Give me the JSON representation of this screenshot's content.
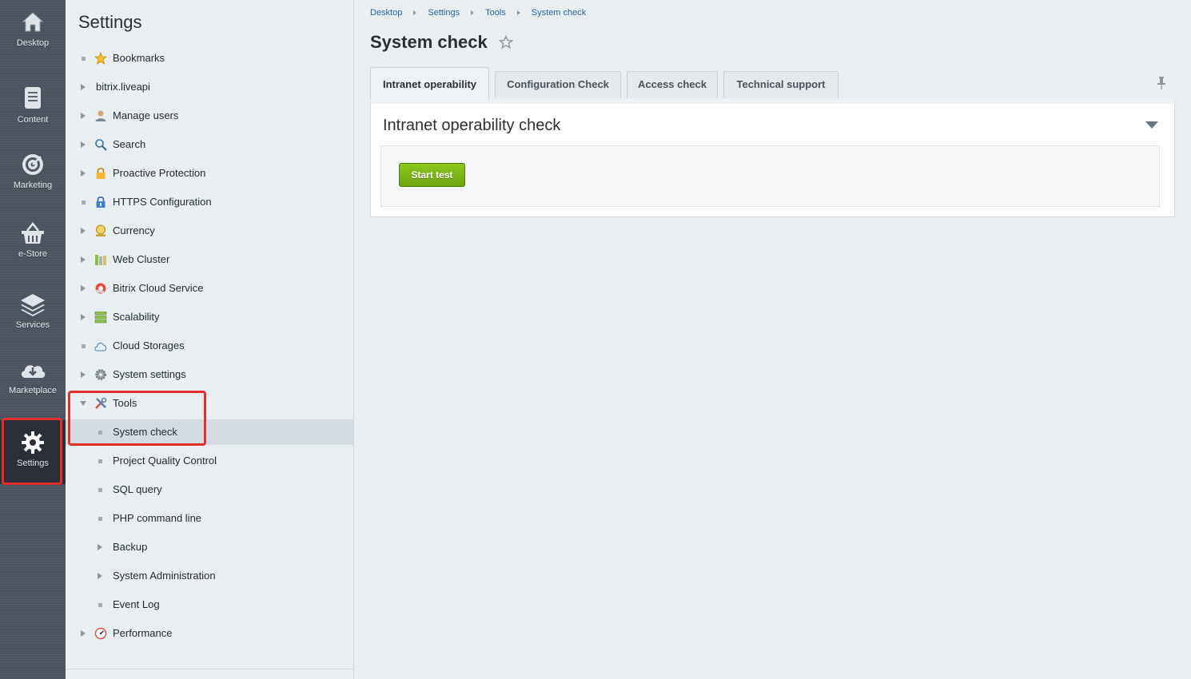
{
  "rail": {
    "items": [
      {
        "label": "Desktop",
        "icon": "home-icon"
      },
      {
        "label": "Content",
        "icon": "document-icon"
      },
      {
        "label": "Marketing",
        "icon": "target-icon"
      },
      {
        "label": "e-Store",
        "icon": "basket-icon"
      },
      {
        "label": "Services",
        "icon": "layers-icon"
      },
      {
        "label": "Marketplace",
        "icon": "cloud-download-icon"
      },
      {
        "label": "Settings",
        "icon": "gear-icon"
      }
    ],
    "active": "Settings"
  },
  "tree": {
    "title": "Settings",
    "items": [
      {
        "label": "Bookmarks",
        "marker": "bullet",
        "icon": "star-icon"
      },
      {
        "label": "bitrix.liveapi",
        "marker": "expand",
        "icon": ""
      },
      {
        "label": "Manage users",
        "marker": "expand",
        "icon": "user-icon"
      },
      {
        "label": "Search",
        "marker": "expand",
        "icon": "magnifier-icon"
      },
      {
        "label": "Proactive Protection",
        "marker": "expand",
        "icon": "padlock-icon"
      },
      {
        "label": "HTTPS Configuration",
        "marker": "bullet",
        "icon": "https-lock-icon"
      },
      {
        "label": "Currency",
        "marker": "expand",
        "icon": "currency-icon"
      },
      {
        "label": "Web Cluster",
        "marker": "expand",
        "icon": "cluster-icon"
      },
      {
        "label": "Bitrix Cloud Service",
        "marker": "expand",
        "icon": "cloud-service-icon"
      },
      {
        "label": "Scalability",
        "marker": "expand",
        "icon": "server-stack-icon"
      },
      {
        "label": "Cloud Storages",
        "marker": "bullet",
        "icon": "cloud-storage-icon"
      },
      {
        "label": "System settings",
        "marker": "expand",
        "icon": "cog-icon"
      },
      {
        "label": "Tools",
        "marker": "collapse",
        "icon": "tools-icon"
      },
      {
        "label": "System check",
        "marker": "bullet",
        "icon": ""
      },
      {
        "label": "Project Quality Control",
        "marker": "bullet",
        "icon": ""
      },
      {
        "label": "SQL query",
        "marker": "bullet",
        "icon": ""
      },
      {
        "label": "PHP command line",
        "marker": "bullet",
        "icon": ""
      },
      {
        "label": "Backup",
        "marker": "expand",
        "icon": ""
      },
      {
        "label": "System Administration",
        "marker": "expand",
        "icon": ""
      },
      {
        "label": "Event Log",
        "marker": "bullet",
        "icon": ""
      },
      {
        "label": "Performance",
        "marker": "expand",
        "icon": "gauge-icon"
      }
    ],
    "selected": "System check"
  },
  "breadcrumb": [
    "Desktop",
    "Settings",
    "Tools",
    "System check"
  ],
  "page_title": "System check",
  "tabs": [
    {
      "label": "Intranet operability",
      "active": true
    },
    {
      "label": "Configuration Check",
      "active": false
    },
    {
      "label": "Access check",
      "active": false
    },
    {
      "label": "Technical support",
      "active": false
    }
  ],
  "panel": {
    "title": "Intranet operability check",
    "start_button": "Start test"
  },
  "colors": {
    "highlight": "#e42d2d",
    "start_button": "#7db818",
    "link": "#2a6496"
  }
}
